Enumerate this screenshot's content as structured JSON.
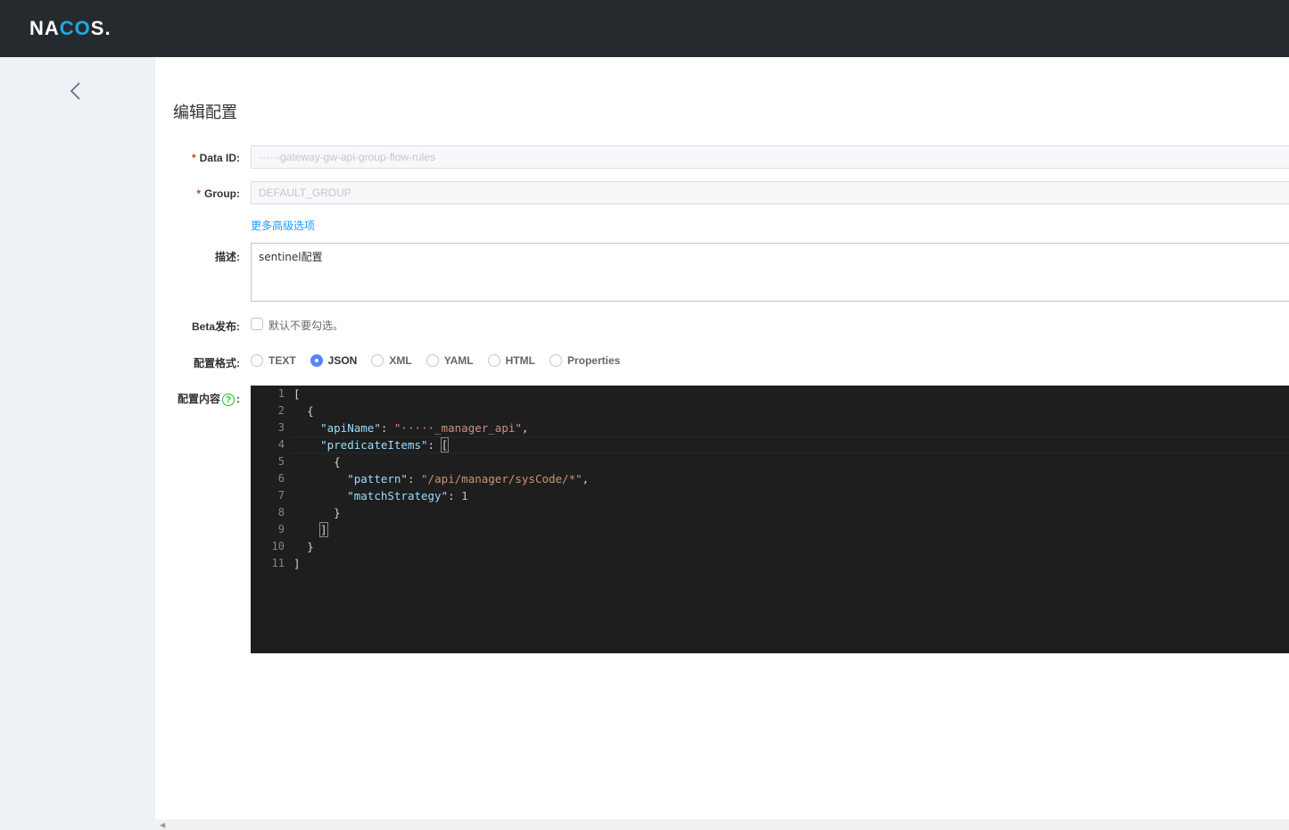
{
  "header": {
    "logo_pre": "NA",
    "logo_oo": "CO",
    "logo_post": "S."
  },
  "page": {
    "title": "编辑配置"
  },
  "form": {
    "data_id": {
      "label": "Data ID:",
      "required": "*",
      "value": "·····-gateway-gw-api-group-flow-rules"
    },
    "group": {
      "label": "Group:",
      "required": "*",
      "value": "DEFAULT_GROUP"
    },
    "advanced_link": "更多高级选项",
    "description": {
      "label": "描述:",
      "value": "sentinel配置"
    },
    "beta": {
      "label": "Beta发布:",
      "checkbox_text": "默认不要勾选。"
    },
    "format": {
      "label": "配置格式:",
      "options": [
        "TEXT",
        "JSON",
        "XML",
        "YAML",
        "HTML",
        "Properties"
      ],
      "selected": "JSON"
    },
    "content": {
      "label_pre": "配置内容",
      "help": "?",
      "label_post": ":"
    }
  },
  "editor": {
    "line_numbers": [
      "1",
      "2",
      "3",
      "4",
      "5",
      "6",
      "7",
      "8",
      "9",
      "10",
      "11"
    ],
    "lines": [
      {
        "indent": "",
        "tokens": [
          {
            "t": "p",
            "v": "["
          }
        ]
      },
      {
        "indent": "  ",
        "tokens": [
          {
            "t": "p",
            "v": "{"
          }
        ]
      },
      {
        "indent": "    ",
        "tokens": [
          {
            "t": "k",
            "v": "\"apiName\""
          },
          {
            "t": "p",
            "v": ": "
          },
          {
            "t": "s",
            "v": "\"·····_manager_api\""
          },
          {
            "t": "p",
            "v": ","
          }
        ]
      },
      {
        "indent": "    ",
        "tokens": [
          {
            "t": "k",
            "v": "\"predicateItems\""
          },
          {
            "t": "p",
            "v": ": "
          },
          {
            "t": "h",
            "v": "["
          }
        ]
      },
      {
        "indent": "      ",
        "tokens": [
          {
            "t": "p",
            "v": "{"
          }
        ]
      },
      {
        "indent": "        ",
        "tokens": [
          {
            "t": "k",
            "v": "\"pattern\""
          },
          {
            "t": "p",
            "v": ": "
          },
          {
            "t": "s",
            "v": "\"/api/manager/sysCode/*\""
          },
          {
            "t": "p",
            "v": ","
          }
        ]
      },
      {
        "indent": "        ",
        "tokens": [
          {
            "t": "k",
            "v": "\"matchStrategy\""
          },
          {
            "t": "p",
            "v": ": "
          },
          {
            "t": "n",
            "v": "1"
          }
        ]
      },
      {
        "indent": "      ",
        "tokens": [
          {
            "t": "p",
            "v": "}"
          }
        ]
      },
      {
        "indent": "    ",
        "tokens": [
          {
            "t": "h",
            "v": "]"
          }
        ]
      },
      {
        "indent": "  ",
        "tokens": [
          {
            "t": "p",
            "v": "}"
          }
        ]
      },
      {
        "indent": "",
        "tokens": [
          {
            "t": "p",
            "v": "]"
          }
        ]
      }
    ]
  }
}
